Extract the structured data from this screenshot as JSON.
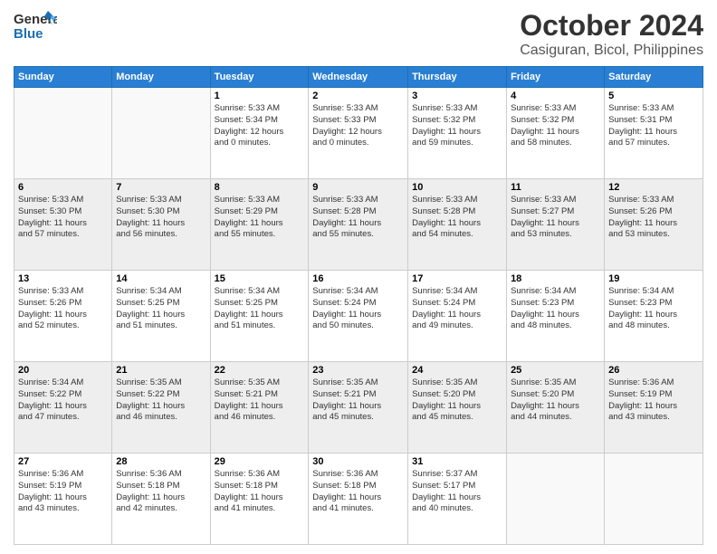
{
  "header": {
    "logo_line1": "General",
    "logo_line2": "Blue",
    "month": "October 2024",
    "location": "Casiguran, Bicol, Philippines"
  },
  "weekdays": [
    "Sunday",
    "Monday",
    "Tuesday",
    "Wednesday",
    "Thursday",
    "Friday",
    "Saturday"
  ],
  "weeks": [
    [
      {
        "day": "",
        "info": ""
      },
      {
        "day": "",
        "info": ""
      },
      {
        "day": "1",
        "info": "Sunrise: 5:33 AM\nSunset: 5:34 PM\nDaylight: 12 hours\nand 0 minutes."
      },
      {
        "day": "2",
        "info": "Sunrise: 5:33 AM\nSunset: 5:33 PM\nDaylight: 12 hours\nand 0 minutes."
      },
      {
        "day": "3",
        "info": "Sunrise: 5:33 AM\nSunset: 5:32 PM\nDaylight: 11 hours\nand 59 minutes."
      },
      {
        "day": "4",
        "info": "Sunrise: 5:33 AM\nSunset: 5:32 PM\nDaylight: 11 hours\nand 58 minutes."
      },
      {
        "day": "5",
        "info": "Sunrise: 5:33 AM\nSunset: 5:31 PM\nDaylight: 11 hours\nand 57 minutes."
      }
    ],
    [
      {
        "day": "6",
        "info": "Sunrise: 5:33 AM\nSunset: 5:30 PM\nDaylight: 11 hours\nand 57 minutes."
      },
      {
        "day": "7",
        "info": "Sunrise: 5:33 AM\nSunset: 5:30 PM\nDaylight: 11 hours\nand 56 minutes."
      },
      {
        "day": "8",
        "info": "Sunrise: 5:33 AM\nSunset: 5:29 PM\nDaylight: 11 hours\nand 55 minutes."
      },
      {
        "day": "9",
        "info": "Sunrise: 5:33 AM\nSunset: 5:28 PM\nDaylight: 11 hours\nand 55 minutes."
      },
      {
        "day": "10",
        "info": "Sunrise: 5:33 AM\nSunset: 5:28 PM\nDaylight: 11 hours\nand 54 minutes."
      },
      {
        "day": "11",
        "info": "Sunrise: 5:33 AM\nSunset: 5:27 PM\nDaylight: 11 hours\nand 53 minutes."
      },
      {
        "day": "12",
        "info": "Sunrise: 5:33 AM\nSunset: 5:26 PM\nDaylight: 11 hours\nand 53 minutes."
      }
    ],
    [
      {
        "day": "13",
        "info": "Sunrise: 5:33 AM\nSunset: 5:26 PM\nDaylight: 11 hours\nand 52 minutes."
      },
      {
        "day": "14",
        "info": "Sunrise: 5:34 AM\nSunset: 5:25 PM\nDaylight: 11 hours\nand 51 minutes."
      },
      {
        "day": "15",
        "info": "Sunrise: 5:34 AM\nSunset: 5:25 PM\nDaylight: 11 hours\nand 51 minutes."
      },
      {
        "day": "16",
        "info": "Sunrise: 5:34 AM\nSunset: 5:24 PM\nDaylight: 11 hours\nand 50 minutes."
      },
      {
        "day": "17",
        "info": "Sunrise: 5:34 AM\nSunset: 5:24 PM\nDaylight: 11 hours\nand 49 minutes."
      },
      {
        "day": "18",
        "info": "Sunrise: 5:34 AM\nSunset: 5:23 PM\nDaylight: 11 hours\nand 48 minutes."
      },
      {
        "day": "19",
        "info": "Sunrise: 5:34 AM\nSunset: 5:23 PM\nDaylight: 11 hours\nand 48 minutes."
      }
    ],
    [
      {
        "day": "20",
        "info": "Sunrise: 5:34 AM\nSunset: 5:22 PM\nDaylight: 11 hours\nand 47 minutes."
      },
      {
        "day": "21",
        "info": "Sunrise: 5:35 AM\nSunset: 5:22 PM\nDaylight: 11 hours\nand 46 minutes."
      },
      {
        "day": "22",
        "info": "Sunrise: 5:35 AM\nSunset: 5:21 PM\nDaylight: 11 hours\nand 46 minutes."
      },
      {
        "day": "23",
        "info": "Sunrise: 5:35 AM\nSunset: 5:21 PM\nDaylight: 11 hours\nand 45 minutes."
      },
      {
        "day": "24",
        "info": "Sunrise: 5:35 AM\nSunset: 5:20 PM\nDaylight: 11 hours\nand 45 minutes."
      },
      {
        "day": "25",
        "info": "Sunrise: 5:35 AM\nSunset: 5:20 PM\nDaylight: 11 hours\nand 44 minutes."
      },
      {
        "day": "26",
        "info": "Sunrise: 5:36 AM\nSunset: 5:19 PM\nDaylight: 11 hours\nand 43 minutes."
      }
    ],
    [
      {
        "day": "27",
        "info": "Sunrise: 5:36 AM\nSunset: 5:19 PM\nDaylight: 11 hours\nand 43 minutes."
      },
      {
        "day": "28",
        "info": "Sunrise: 5:36 AM\nSunset: 5:18 PM\nDaylight: 11 hours\nand 42 minutes."
      },
      {
        "day": "29",
        "info": "Sunrise: 5:36 AM\nSunset: 5:18 PM\nDaylight: 11 hours\nand 41 minutes."
      },
      {
        "day": "30",
        "info": "Sunrise: 5:36 AM\nSunset: 5:18 PM\nDaylight: 11 hours\nand 41 minutes."
      },
      {
        "day": "31",
        "info": "Sunrise: 5:37 AM\nSunset: 5:17 PM\nDaylight: 11 hours\nand 40 minutes."
      },
      {
        "day": "",
        "info": ""
      },
      {
        "day": "",
        "info": ""
      }
    ]
  ]
}
